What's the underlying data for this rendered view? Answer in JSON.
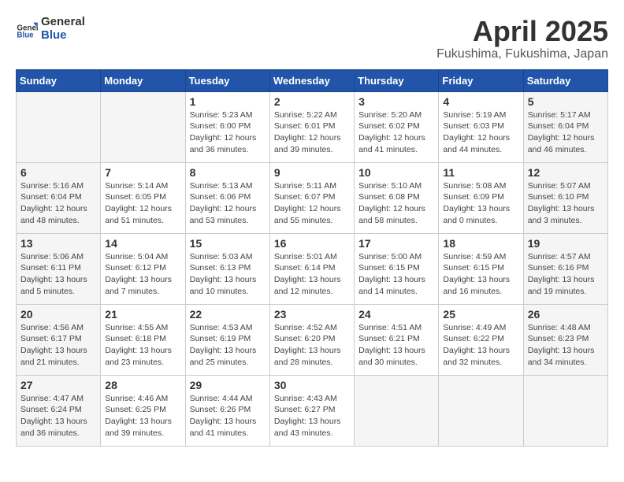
{
  "logo": {
    "text_general": "General",
    "text_blue": "Blue"
  },
  "header": {
    "title": "April 2025",
    "subtitle": "Fukushima, Fukushima, Japan"
  },
  "weekdays": [
    "Sunday",
    "Monday",
    "Tuesday",
    "Wednesday",
    "Thursday",
    "Friday",
    "Saturday"
  ],
  "weeks": [
    [
      {
        "day": "",
        "info": ""
      },
      {
        "day": "",
        "info": ""
      },
      {
        "day": "1",
        "sunrise": "5:23 AM",
        "sunset": "6:00 PM",
        "daylight": "12 hours and 36 minutes."
      },
      {
        "day": "2",
        "sunrise": "5:22 AM",
        "sunset": "6:01 PM",
        "daylight": "12 hours and 39 minutes."
      },
      {
        "day": "3",
        "sunrise": "5:20 AM",
        "sunset": "6:02 PM",
        "daylight": "12 hours and 41 minutes."
      },
      {
        "day": "4",
        "sunrise": "5:19 AM",
        "sunset": "6:03 PM",
        "daylight": "12 hours and 44 minutes."
      },
      {
        "day": "5",
        "sunrise": "5:17 AM",
        "sunset": "6:04 PM",
        "daylight": "12 hours and 46 minutes."
      }
    ],
    [
      {
        "day": "6",
        "sunrise": "5:16 AM",
        "sunset": "6:04 PM",
        "daylight": "12 hours and 48 minutes."
      },
      {
        "day": "7",
        "sunrise": "5:14 AM",
        "sunset": "6:05 PM",
        "daylight": "12 hours and 51 minutes."
      },
      {
        "day": "8",
        "sunrise": "5:13 AM",
        "sunset": "6:06 PM",
        "daylight": "12 hours and 53 minutes."
      },
      {
        "day": "9",
        "sunrise": "5:11 AM",
        "sunset": "6:07 PM",
        "daylight": "12 hours and 55 minutes."
      },
      {
        "day": "10",
        "sunrise": "5:10 AM",
        "sunset": "6:08 PM",
        "daylight": "12 hours and 58 minutes."
      },
      {
        "day": "11",
        "sunrise": "5:08 AM",
        "sunset": "6:09 PM",
        "daylight": "13 hours and 0 minutes."
      },
      {
        "day": "12",
        "sunrise": "5:07 AM",
        "sunset": "6:10 PM",
        "daylight": "13 hours and 3 minutes."
      }
    ],
    [
      {
        "day": "13",
        "sunrise": "5:06 AM",
        "sunset": "6:11 PM",
        "daylight": "13 hours and 5 minutes."
      },
      {
        "day": "14",
        "sunrise": "5:04 AM",
        "sunset": "6:12 PM",
        "daylight": "13 hours and 7 minutes."
      },
      {
        "day": "15",
        "sunrise": "5:03 AM",
        "sunset": "6:13 PM",
        "daylight": "13 hours and 10 minutes."
      },
      {
        "day": "16",
        "sunrise": "5:01 AM",
        "sunset": "6:14 PM",
        "daylight": "13 hours and 12 minutes."
      },
      {
        "day": "17",
        "sunrise": "5:00 AM",
        "sunset": "6:15 PM",
        "daylight": "13 hours and 14 minutes."
      },
      {
        "day": "18",
        "sunrise": "4:59 AM",
        "sunset": "6:15 PM",
        "daylight": "13 hours and 16 minutes."
      },
      {
        "day": "19",
        "sunrise": "4:57 AM",
        "sunset": "6:16 PM",
        "daylight": "13 hours and 19 minutes."
      }
    ],
    [
      {
        "day": "20",
        "sunrise": "4:56 AM",
        "sunset": "6:17 PM",
        "daylight": "13 hours and 21 minutes."
      },
      {
        "day": "21",
        "sunrise": "4:55 AM",
        "sunset": "6:18 PM",
        "daylight": "13 hours and 23 minutes."
      },
      {
        "day": "22",
        "sunrise": "4:53 AM",
        "sunset": "6:19 PM",
        "daylight": "13 hours and 25 minutes."
      },
      {
        "day": "23",
        "sunrise": "4:52 AM",
        "sunset": "6:20 PM",
        "daylight": "13 hours and 28 minutes."
      },
      {
        "day": "24",
        "sunrise": "4:51 AM",
        "sunset": "6:21 PM",
        "daylight": "13 hours and 30 minutes."
      },
      {
        "day": "25",
        "sunrise": "4:49 AM",
        "sunset": "6:22 PM",
        "daylight": "13 hours and 32 minutes."
      },
      {
        "day": "26",
        "sunrise": "4:48 AM",
        "sunset": "6:23 PM",
        "daylight": "13 hours and 34 minutes."
      }
    ],
    [
      {
        "day": "27",
        "sunrise": "4:47 AM",
        "sunset": "6:24 PM",
        "daylight": "13 hours and 36 minutes."
      },
      {
        "day": "28",
        "sunrise": "4:46 AM",
        "sunset": "6:25 PM",
        "daylight": "13 hours and 39 minutes."
      },
      {
        "day": "29",
        "sunrise": "4:44 AM",
        "sunset": "6:26 PM",
        "daylight": "13 hours and 41 minutes."
      },
      {
        "day": "30",
        "sunrise": "4:43 AM",
        "sunset": "6:27 PM",
        "daylight": "13 hours and 43 minutes."
      },
      {
        "day": "",
        "info": ""
      },
      {
        "day": "",
        "info": ""
      },
      {
        "day": "",
        "info": ""
      }
    ]
  ]
}
